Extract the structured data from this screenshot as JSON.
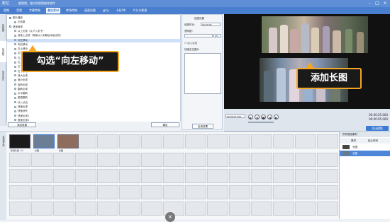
{
  "app": {
    "logo_text": "影忆",
    "title": "超视频，强大的视频制作软件"
  },
  "menu": {
    "items": [
      "视频",
      "音频",
      "字幕特效",
      "叠加素材",
      "转场特效",
      "画面风格",
      "MTV",
      "卡拉OK",
      "片头与影尾"
    ],
    "active_index": 3
  },
  "left_tabs": [
    "加贴图",
    "加边框",
    "加去水印"
  ],
  "effects_list": [
    {
      "label": "图片播放",
      "type": "header"
    },
    {
      "label": "无效果",
      "type": "item"
    },
    {
      "label": "逐渐隐现",
      "type": "header"
    },
    {
      "label": "从上出现（从下入到下）",
      "type": "item"
    },
    {
      "label": "逐渐上出现（渐隐从入到最后动画出现）",
      "type": "item"
    },
    {
      "label": "向左移动",
      "type": "item",
      "selected": true
    },
    {
      "label": "向右移动",
      "type": "item"
    },
    {
      "label": "向上移动",
      "type": "item"
    },
    {
      "label": "向下移动",
      "type": "item"
    },
    {
      "label": "左上移动",
      "type": "item"
    },
    {
      "label": "右上移动",
      "type": "item"
    },
    {
      "label": "左下移动",
      "type": "item"
    },
    {
      "label": "右下移动",
      "type": "item"
    },
    {
      "label": "放大出现",
      "type": "item"
    },
    {
      "label": "缩小出现",
      "type": "item"
    },
    {
      "label": "旋转出现",
      "type": "item"
    },
    {
      "label": "翻转出现",
      "type": "item"
    },
    {
      "label": "水平翻转",
      "type": "item"
    },
    {
      "label": "垂直翻转",
      "type": "item"
    },
    {
      "label": "淡入淡出",
      "type": "item"
    },
    {
      "label": "快速出现",
      "type": "item"
    },
    {
      "label": "快速消失",
      "type": "item"
    },
    {
      "label": "快速出现2",
      "type": "item"
    },
    {
      "label": "慢速出现2",
      "type": "item"
    }
  ],
  "list_bottom": {
    "add_button": "添加效果",
    "ok_button": "确定"
  },
  "side": {
    "title": "贴图设置",
    "duration_label": "贴图时长：",
    "duration_value": "00:00:05",
    "opacity_label": "透明度：",
    "opacity_value": "0%",
    "option1": "淡入淡出",
    "option2": "快速定位图片",
    "apply_button": "应用效果"
  },
  "callouts": {
    "left": "勾选“向左移动”",
    "right": "添加长图"
  },
  "controls": {
    "time_field": "00:00:01.000",
    "time_current": "00:00:25.000",
    "time_total": "00:00:05.000",
    "export_label": "导出视频"
  },
  "timeline": {
    "tabs": [
      "已添加片段"
    ],
    "clips": [
      "影视片段（1）",
      "长图",
      "长图"
    ]
  },
  "rightpanel": {
    "header": "所有叠加素材",
    "col1": "素材",
    "col2": "起止时间",
    "rows": [
      "长图",
      "长图"
    ]
  }
}
